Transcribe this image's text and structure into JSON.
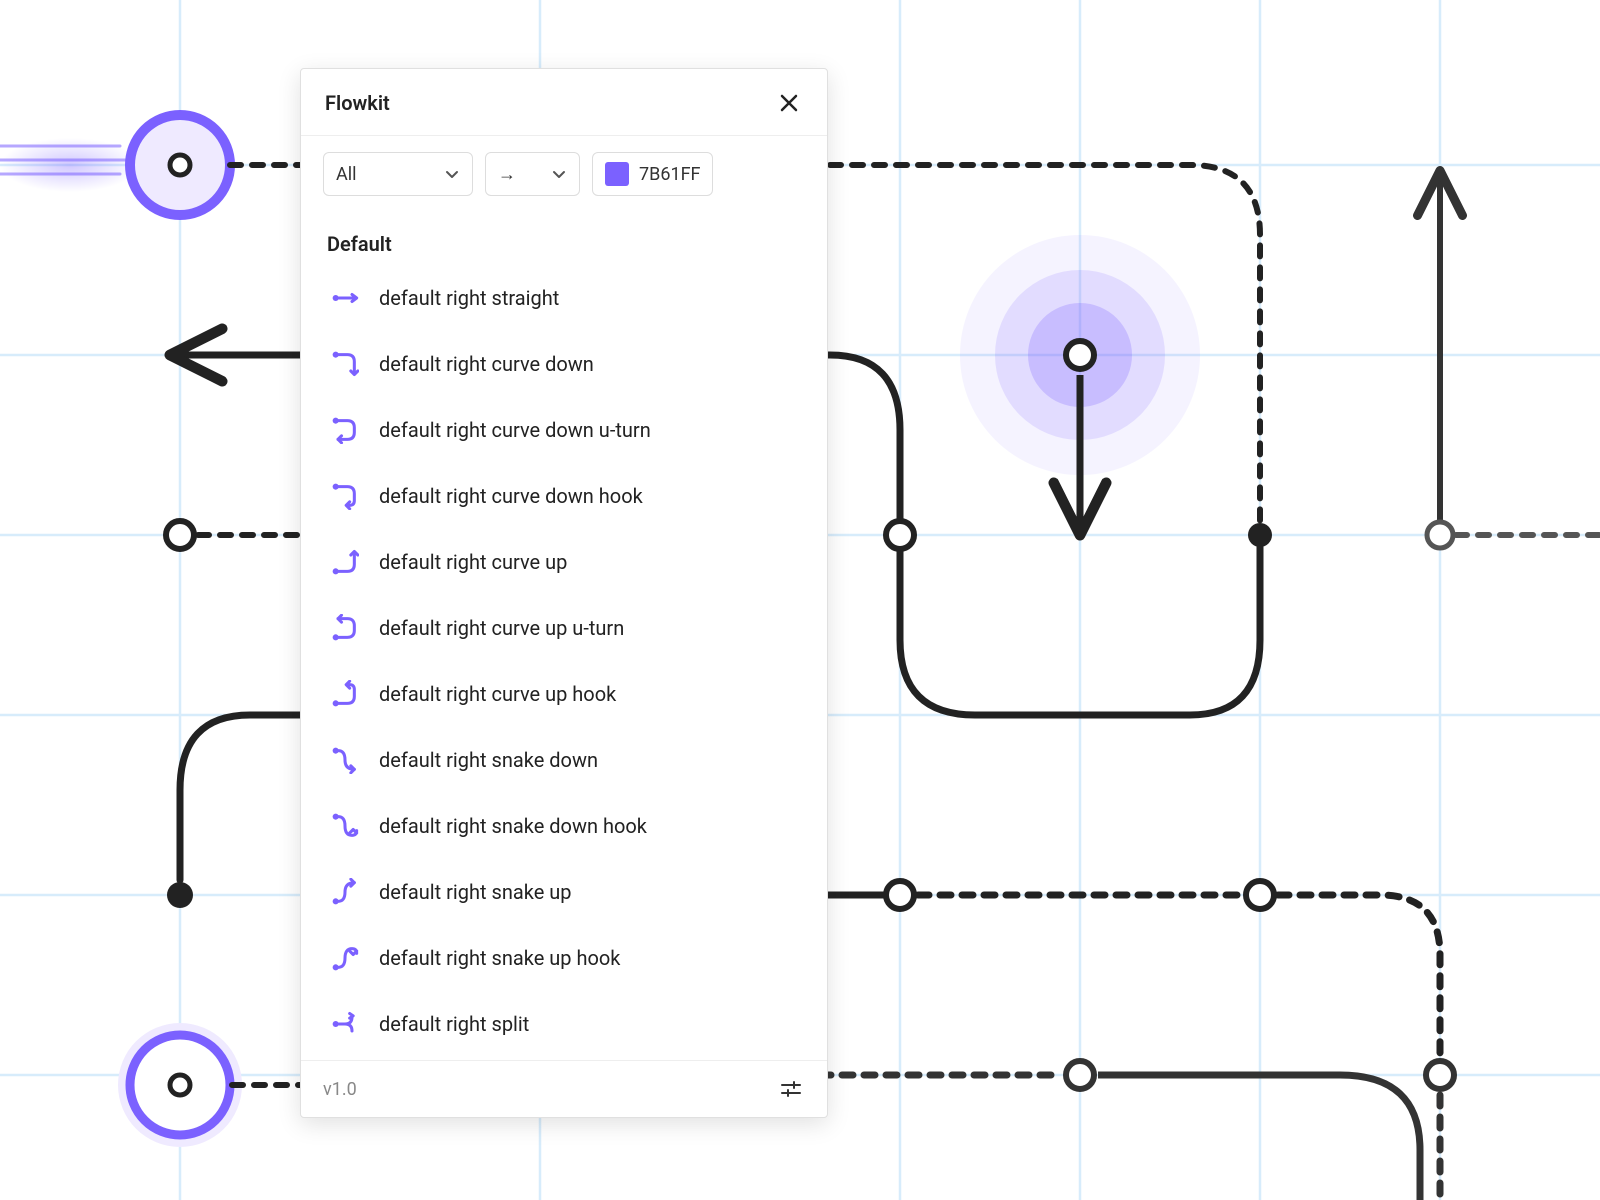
{
  "panel": {
    "title": "Flowkit",
    "footer_version": "v1.0",
    "toolbar": {
      "type_filter": "All",
      "direction_glyph": "→",
      "color_hex": "7B61FF",
      "color_swatch": "#7B61FF"
    },
    "group_label": "Default",
    "items": [
      {
        "label": "default right straight",
        "icon": "flow-right-straight"
      },
      {
        "label": "default right curve down",
        "icon": "flow-right-curve-down"
      },
      {
        "label": "default right curve down u-turn",
        "icon": "flow-right-curve-down-uturn"
      },
      {
        "label": "default right curve down hook",
        "icon": "flow-right-curve-down-hook"
      },
      {
        "label": "default right curve up",
        "icon": "flow-right-curve-up"
      },
      {
        "label": "default right curve up u-turn",
        "icon": "flow-right-curve-up-uturn"
      },
      {
        "label": "default right curve up hook",
        "icon": "flow-right-curve-up-hook"
      },
      {
        "label": "default right snake down",
        "icon": "flow-right-snake-down"
      },
      {
        "label": "default right snake down hook",
        "icon": "flow-right-snake-down-hook"
      },
      {
        "label": "default right snake up",
        "icon": "flow-right-snake-up"
      },
      {
        "label": "default right snake up hook",
        "icon": "flow-right-snake-up-hook"
      },
      {
        "label": "default right split",
        "icon": "flow-right-split"
      }
    ]
  },
  "canvas": {
    "accent_color": "#7B61FF",
    "line_color": "#222",
    "grid_color": "#d7ecfb"
  }
}
